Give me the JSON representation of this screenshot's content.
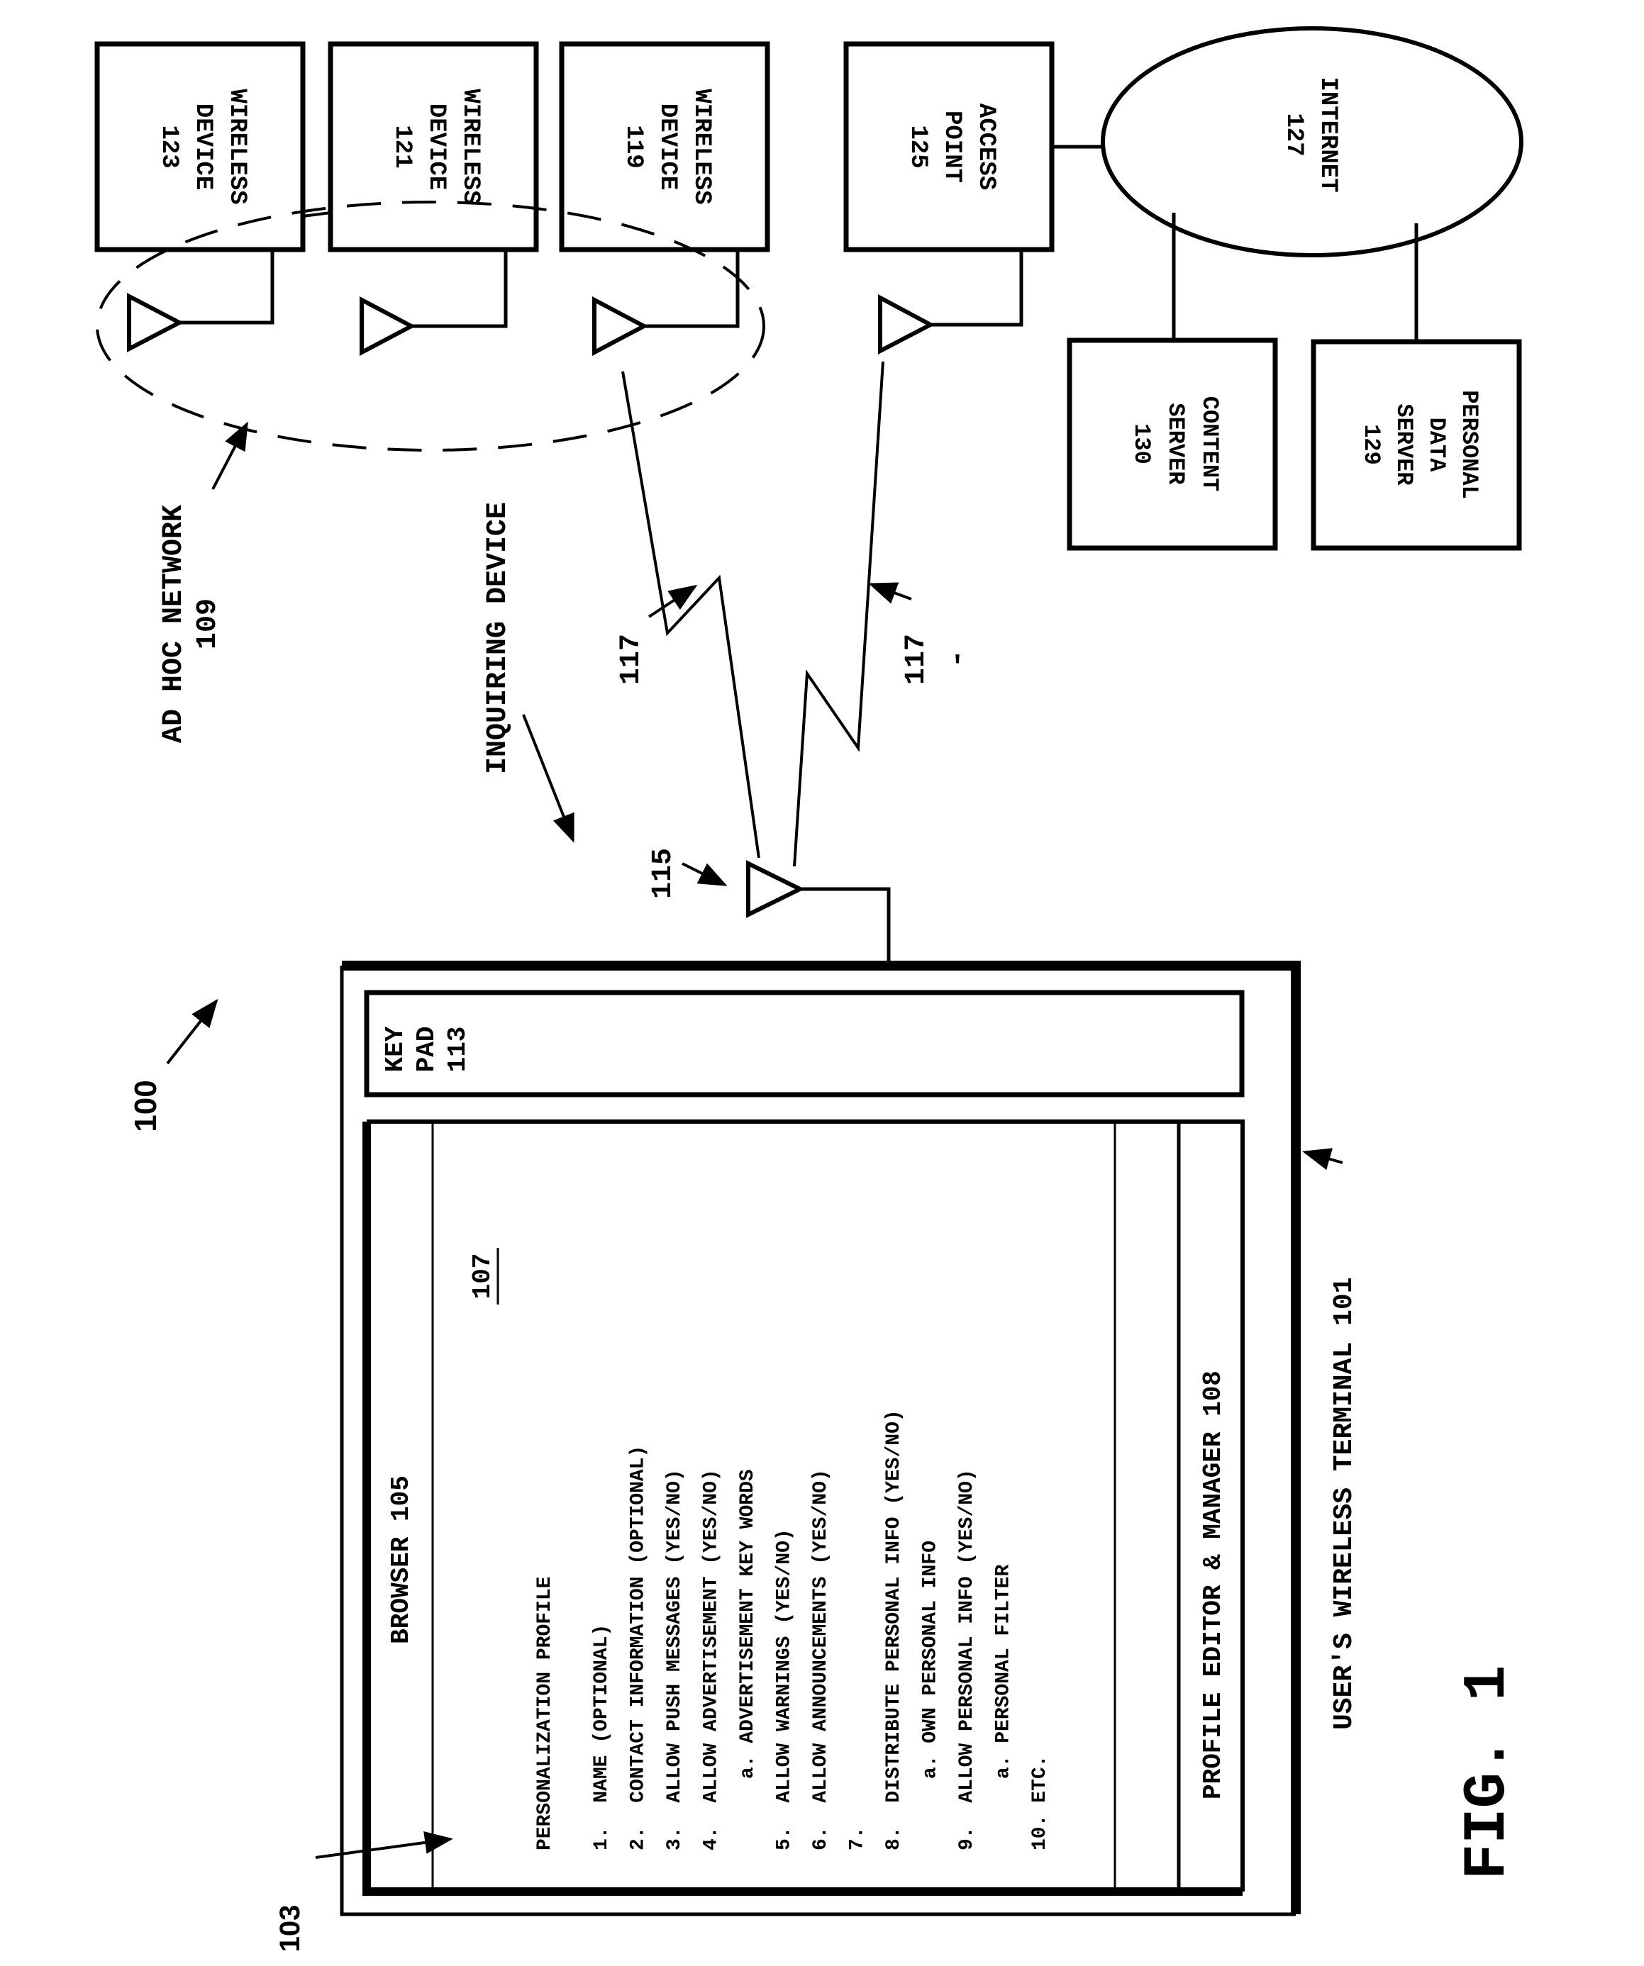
{
  "figure": {
    "system_ref": "100",
    "caption": "FIG. 1"
  },
  "wireless_devices": [
    {
      "line1": "WIRELESS",
      "line2": "DEVICE",
      "ref": "123"
    },
    {
      "line1": "WIRELESS",
      "line2": "DEVICE",
      "ref": "121"
    },
    {
      "line1": "WIRELESS",
      "line2": "DEVICE",
      "ref": "119"
    }
  ],
  "access_point": {
    "line1": "ACCESS",
    "line2": "POINT",
    "ref": "125"
  },
  "internet": {
    "line1": "INTERNET",
    "ref": "127"
  },
  "content_server": {
    "line1": "CONTENT",
    "line2": "SERVER",
    "ref": "130"
  },
  "personal_data_server": {
    "line1": "PERSONAL",
    "line2": "DATA",
    "line3": "SERVER",
    "ref": "129"
  },
  "ad_hoc_network": {
    "label": "AD HOC NETWORK",
    "ref": "109"
  },
  "inquiring_device": {
    "label": "INQUIRING DEVICE"
  },
  "links": {
    "link_a_ref": "117",
    "link_b_ref": "117",
    "link_b_prime": "'",
    "antenna_ref": "115"
  },
  "terminal": {
    "label": "USER'S WIRELESS TERMINAL 101",
    "display_ref": "103",
    "keypad": {
      "line1": "KEY",
      "line2": "PAD",
      "ref": "113"
    },
    "browser_title": "BROWSER 105",
    "profile_ref": "107",
    "profile_heading": "PERSONALIZATION PROFILE",
    "profile_items": [
      "1.  NAME (OPTIONAL)",
      "2.  CONTACT INFORMATION (OPTIONAL)",
      "3.  ALLOW PUSH MESSAGES (YES/NO)",
      "4.  ALLOW ADVERTISEMENT (YES/NO)",
      "      a. ADVERTISEMENT KEY WORDS",
      "5.  ALLOW WARNINGS (YES/NO)",
      "6.  ALLOW ANNOUNCEMENTS (YES/NO)",
      "7.",
      "8.  DISTRIBUTE PERSONAL INFO (YES/NO)",
      "      a. OWN PERSONAL INFO",
      "9.  ALLOW PERSONAL INFO (YES/NO)",
      "      a. PERSONAL FILTER",
      "10. ETC."
    ],
    "editor_label": "PROFILE EDITOR & MANAGER 108"
  }
}
